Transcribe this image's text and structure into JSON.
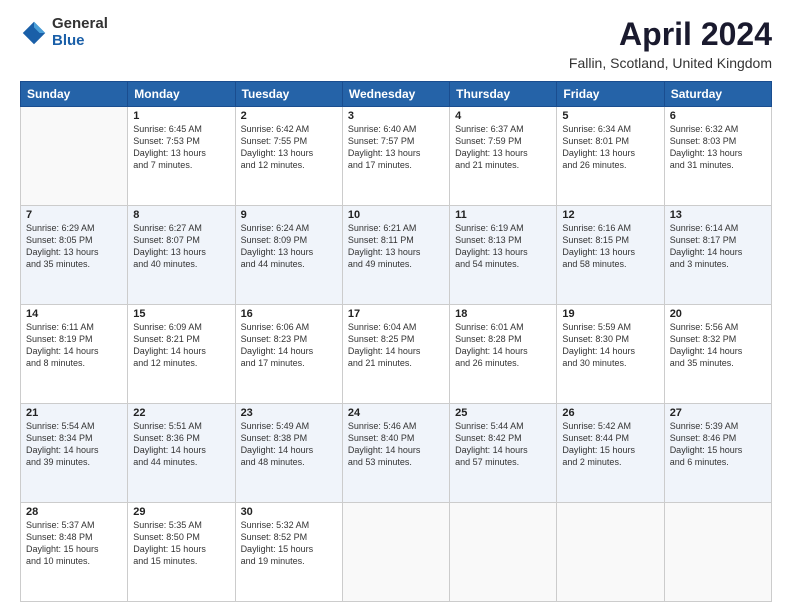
{
  "logo": {
    "general": "General",
    "blue": "Blue"
  },
  "title": "April 2024",
  "subtitle": "Fallin, Scotland, United Kingdom",
  "days": [
    "Sunday",
    "Monday",
    "Tuesday",
    "Wednesday",
    "Thursday",
    "Friday",
    "Saturday"
  ],
  "weeks": [
    [
      {
        "num": "",
        "lines": []
      },
      {
        "num": "1",
        "lines": [
          "Sunrise: 6:45 AM",
          "Sunset: 7:53 PM",
          "Daylight: 13 hours",
          "and 7 minutes."
        ]
      },
      {
        "num": "2",
        "lines": [
          "Sunrise: 6:42 AM",
          "Sunset: 7:55 PM",
          "Daylight: 13 hours",
          "and 12 minutes."
        ]
      },
      {
        "num": "3",
        "lines": [
          "Sunrise: 6:40 AM",
          "Sunset: 7:57 PM",
          "Daylight: 13 hours",
          "and 17 minutes."
        ]
      },
      {
        "num": "4",
        "lines": [
          "Sunrise: 6:37 AM",
          "Sunset: 7:59 PM",
          "Daylight: 13 hours",
          "and 21 minutes."
        ]
      },
      {
        "num": "5",
        "lines": [
          "Sunrise: 6:34 AM",
          "Sunset: 8:01 PM",
          "Daylight: 13 hours",
          "and 26 minutes."
        ]
      },
      {
        "num": "6",
        "lines": [
          "Sunrise: 6:32 AM",
          "Sunset: 8:03 PM",
          "Daylight: 13 hours",
          "and 31 minutes."
        ]
      }
    ],
    [
      {
        "num": "7",
        "lines": [
          "Sunrise: 6:29 AM",
          "Sunset: 8:05 PM",
          "Daylight: 13 hours",
          "and 35 minutes."
        ]
      },
      {
        "num": "8",
        "lines": [
          "Sunrise: 6:27 AM",
          "Sunset: 8:07 PM",
          "Daylight: 13 hours",
          "and 40 minutes."
        ]
      },
      {
        "num": "9",
        "lines": [
          "Sunrise: 6:24 AM",
          "Sunset: 8:09 PM",
          "Daylight: 13 hours",
          "and 44 minutes."
        ]
      },
      {
        "num": "10",
        "lines": [
          "Sunrise: 6:21 AM",
          "Sunset: 8:11 PM",
          "Daylight: 13 hours",
          "and 49 minutes."
        ]
      },
      {
        "num": "11",
        "lines": [
          "Sunrise: 6:19 AM",
          "Sunset: 8:13 PM",
          "Daylight: 13 hours",
          "and 54 minutes."
        ]
      },
      {
        "num": "12",
        "lines": [
          "Sunrise: 6:16 AM",
          "Sunset: 8:15 PM",
          "Daylight: 13 hours",
          "and 58 minutes."
        ]
      },
      {
        "num": "13",
        "lines": [
          "Sunrise: 6:14 AM",
          "Sunset: 8:17 PM",
          "Daylight: 14 hours",
          "and 3 minutes."
        ]
      }
    ],
    [
      {
        "num": "14",
        "lines": [
          "Sunrise: 6:11 AM",
          "Sunset: 8:19 PM",
          "Daylight: 14 hours",
          "and 8 minutes."
        ]
      },
      {
        "num": "15",
        "lines": [
          "Sunrise: 6:09 AM",
          "Sunset: 8:21 PM",
          "Daylight: 14 hours",
          "and 12 minutes."
        ]
      },
      {
        "num": "16",
        "lines": [
          "Sunrise: 6:06 AM",
          "Sunset: 8:23 PM",
          "Daylight: 14 hours",
          "and 17 minutes."
        ]
      },
      {
        "num": "17",
        "lines": [
          "Sunrise: 6:04 AM",
          "Sunset: 8:25 PM",
          "Daylight: 14 hours",
          "and 21 minutes."
        ]
      },
      {
        "num": "18",
        "lines": [
          "Sunrise: 6:01 AM",
          "Sunset: 8:28 PM",
          "Daylight: 14 hours",
          "and 26 minutes."
        ]
      },
      {
        "num": "19",
        "lines": [
          "Sunrise: 5:59 AM",
          "Sunset: 8:30 PM",
          "Daylight: 14 hours",
          "and 30 minutes."
        ]
      },
      {
        "num": "20",
        "lines": [
          "Sunrise: 5:56 AM",
          "Sunset: 8:32 PM",
          "Daylight: 14 hours",
          "and 35 minutes."
        ]
      }
    ],
    [
      {
        "num": "21",
        "lines": [
          "Sunrise: 5:54 AM",
          "Sunset: 8:34 PM",
          "Daylight: 14 hours",
          "and 39 minutes."
        ]
      },
      {
        "num": "22",
        "lines": [
          "Sunrise: 5:51 AM",
          "Sunset: 8:36 PM",
          "Daylight: 14 hours",
          "and 44 minutes."
        ]
      },
      {
        "num": "23",
        "lines": [
          "Sunrise: 5:49 AM",
          "Sunset: 8:38 PM",
          "Daylight: 14 hours",
          "and 48 minutes."
        ]
      },
      {
        "num": "24",
        "lines": [
          "Sunrise: 5:46 AM",
          "Sunset: 8:40 PM",
          "Daylight: 14 hours",
          "and 53 minutes."
        ]
      },
      {
        "num": "25",
        "lines": [
          "Sunrise: 5:44 AM",
          "Sunset: 8:42 PM",
          "Daylight: 14 hours",
          "and 57 minutes."
        ]
      },
      {
        "num": "26",
        "lines": [
          "Sunrise: 5:42 AM",
          "Sunset: 8:44 PM",
          "Daylight: 15 hours",
          "and 2 minutes."
        ]
      },
      {
        "num": "27",
        "lines": [
          "Sunrise: 5:39 AM",
          "Sunset: 8:46 PM",
          "Daylight: 15 hours",
          "and 6 minutes."
        ]
      }
    ],
    [
      {
        "num": "28",
        "lines": [
          "Sunrise: 5:37 AM",
          "Sunset: 8:48 PM",
          "Daylight: 15 hours",
          "and 10 minutes."
        ]
      },
      {
        "num": "29",
        "lines": [
          "Sunrise: 5:35 AM",
          "Sunset: 8:50 PM",
          "Daylight: 15 hours",
          "and 15 minutes."
        ]
      },
      {
        "num": "30",
        "lines": [
          "Sunrise: 5:32 AM",
          "Sunset: 8:52 PM",
          "Daylight: 15 hours",
          "and 19 minutes."
        ]
      },
      {
        "num": "",
        "lines": []
      },
      {
        "num": "",
        "lines": []
      },
      {
        "num": "",
        "lines": []
      },
      {
        "num": "",
        "lines": []
      }
    ]
  ]
}
